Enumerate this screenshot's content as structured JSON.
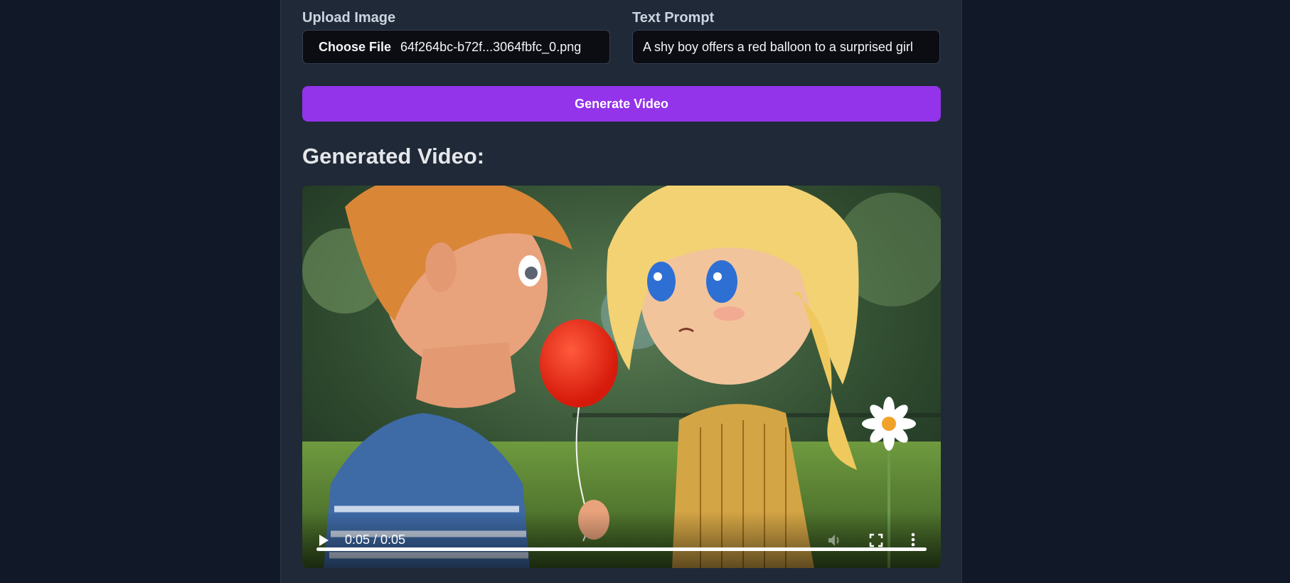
{
  "upload": {
    "label": "Upload Image",
    "button_label": "Choose File",
    "file_name": "64f264bc-b72f...3064fbfc_0.png"
  },
  "prompt": {
    "label": "Text Prompt",
    "value": "A shy boy offers a red balloon to a surprised girl"
  },
  "generate_button": {
    "label": "Generate Video"
  },
  "result": {
    "heading": "Generated Video:"
  },
  "video": {
    "time_display": "0:05 / 0:05",
    "progress": 1.0,
    "icons": {
      "play": "play-icon",
      "mute": "volume-icon",
      "fullscreen": "fullscreen-icon",
      "more": "more-options-icon"
    }
  },
  "colors": {
    "accent": "#9333ea",
    "background": "#111827",
    "panel": "#1f2937"
  }
}
